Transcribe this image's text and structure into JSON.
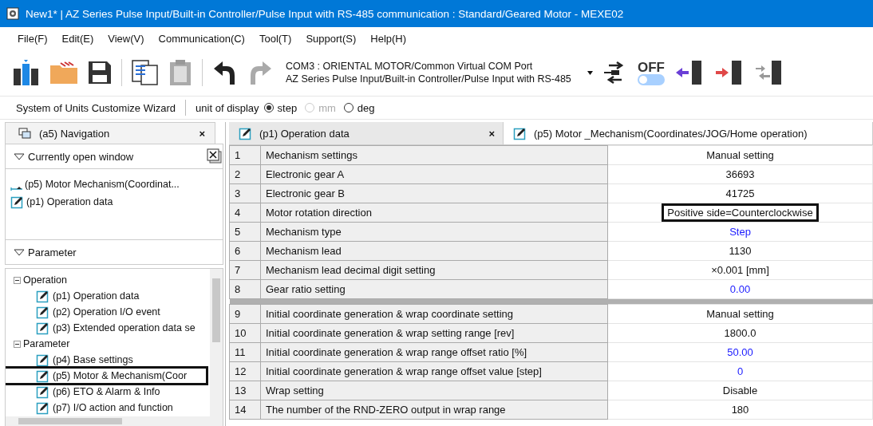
{
  "window": {
    "title": "New1* | AZ Series Pulse Input/Built-in Controller/Pulse Input with RS-485 communication : Standard/Geared Motor - MEXE02"
  },
  "menu": [
    "File(F)",
    "Edit(E)",
    "View(V)",
    "Communication(C)",
    "Tool(T)",
    "Support(S)",
    "Help(H)"
  ],
  "toolbar": {
    "com_port": "COM3 : ORIENTAL MOTOR/Common Virtual COM Port",
    "product": "AZ Series Pulse Input/Built-in Controller/Pulse Input with RS-485",
    "toggle_label": "OFF",
    "toggle_on": false
  },
  "units_bar": {
    "wizard": "System of Units Customize Wizard",
    "label": "unit of display",
    "options": [
      {
        "label": "step",
        "selected": true,
        "disabled": false
      },
      {
        "label": "mm",
        "selected": false,
        "disabled": true
      },
      {
        "label": "deg",
        "selected": false,
        "disabled": false
      }
    ]
  },
  "navigation": {
    "tab": "(a5) Navigation",
    "close": "×",
    "open_windows_header": "Currently open window",
    "open_windows": [
      {
        "label": "(p5) Motor  Mechanism(Coordinat...",
        "kind": "mechanism"
      },
      {
        "label": "(p1) Operation data",
        "kind": "edit"
      }
    ],
    "parameter_header": "Parameter",
    "tree": [
      {
        "label": "Operation",
        "expanded": true,
        "children": [
          {
            "label": "(p1) Operation data",
            "highlighted": false
          },
          {
            "label": "(p2) Operation I/O event",
            "highlighted": false
          },
          {
            "label": "(p3) Extended operation data se",
            "highlighted": false
          }
        ]
      },
      {
        "label": "Parameter",
        "expanded": true,
        "children": [
          {
            "label": "(p4) Base settings",
            "highlighted": false
          },
          {
            "label": "(p5) Motor & Mechanism(Coor",
            "highlighted": true
          },
          {
            "label": "(p6) ETO & Alarm & Info",
            "highlighted": false
          },
          {
            "label": "(p7) I/O action and function",
            "highlighted": false
          }
        ]
      }
    ]
  },
  "tabs": [
    {
      "label": "(p1) Operation data",
      "close": "×",
      "selected": false
    },
    {
      "label": "(p5) Motor _Mechanism(Coordinates/JOG/Home operation)",
      "selected": true
    }
  ],
  "table": {
    "groups": [
      [
        {
          "no": "1",
          "name": "Mechanism settings",
          "value": "Manual setting",
          "modified": false,
          "highlighted": false
        },
        {
          "no": "2",
          "name": "Electronic gear A",
          "value": "36693",
          "modified": false,
          "highlighted": false
        },
        {
          "no": "3",
          "name": "Electronic gear B",
          "value": "41725",
          "modified": false,
          "highlighted": false
        },
        {
          "no": "4",
          "name": "Motor rotation direction",
          "value": "Positive side=Counterclockwise",
          "modified": false,
          "highlighted": true
        },
        {
          "no": "5",
          "name": "Mechanism type",
          "value": "Step",
          "modified": true,
          "highlighted": false
        },
        {
          "no": "6",
          "name": "Mechanism lead",
          "value": "1130",
          "modified": false,
          "highlighted": false
        },
        {
          "no": "7",
          "name": "Mechanism lead decimal digit setting",
          "value": "×0.001 [mm]",
          "modified": false,
          "highlighted": false
        },
        {
          "no": "8",
          "name": "Gear ratio setting",
          "value": "0.00",
          "modified": true,
          "highlighted": false
        }
      ],
      [
        {
          "no": "9",
          "name": "Initial coordinate generation & wrap coordinate setting",
          "value": "Manual setting",
          "modified": false,
          "highlighted": false
        },
        {
          "no": "10",
          "name": "Initial coordinate generation & wrap setting range [rev]",
          "value": "1800.0",
          "modified": false,
          "highlighted": false
        },
        {
          "no": "11",
          "name": "Initial coordinate generation & wrap range offset ratio [%]",
          "value": "50.00",
          "modified": true,
          "highlighted": false
        },
        {
          "no": "12",
          "name": "Initial coordinate generation & wrap range offset value [step]",
          "value": "0",
          "modified": true,
          "highlighted": false
        },
        {
          "no": "13",
          "name": "Wrap setting",
          "value": "Disable",
          "modified": false,
          "highlighted": false
        },
        {
          "no": "14",
          "name": "The number of the RND-ZERO output in wrap range",
          "value": "180",
          "modified": false,
          "highlighted": false
        }
      ]
    ]
  }
}
